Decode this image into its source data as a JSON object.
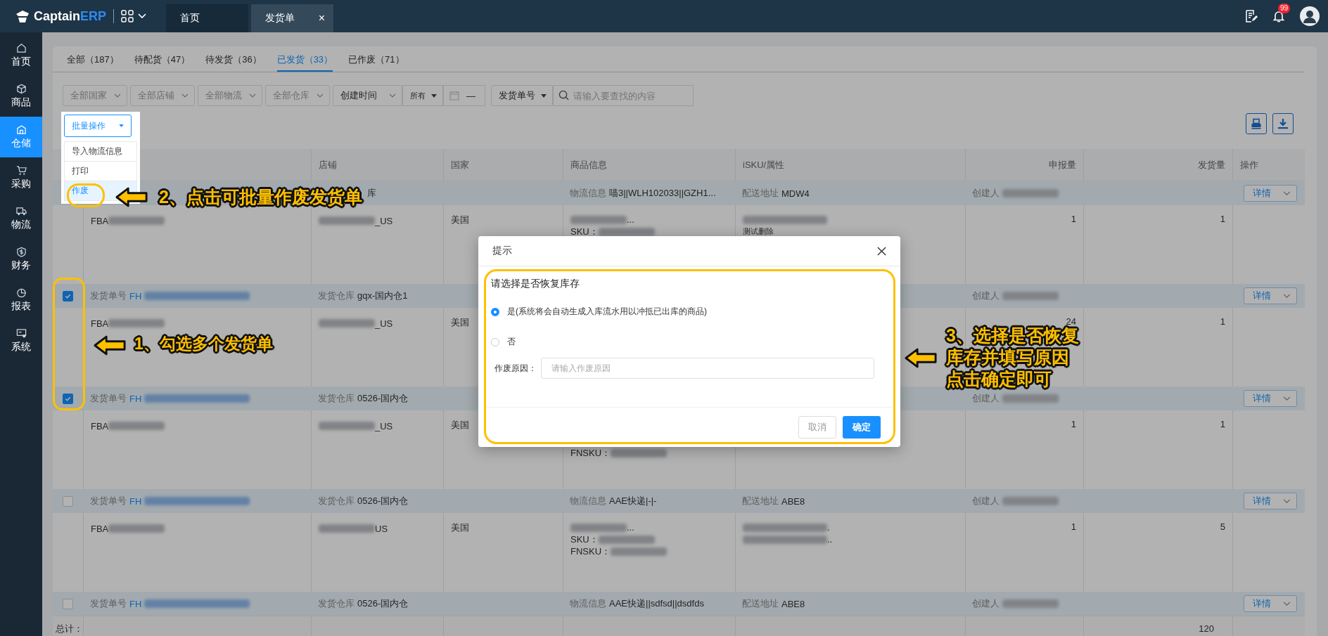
{
  "topbar": {
    "logo": {
      "part1": "Captain",
      "part2": "ERP"
    },
    "tabs": [
      {
        "label": "首页",
        "selected": false
      },
      {
        "label": "发货单",
        "selected": true,
        "close": "×"
      }
    ],
    "badge": "99"
  },
  "sidebar": [
    {
      "label": "首页",
      "selected": false
    },
    {
      "label": "商品",
      "selected": false
    },
    {
      "label": "仓储",
      "selected": true
    },
    {
      "label": "采购",
      "selected": false
    },
    {
      "label": "物流",
      "selected": false
    },
    {
      "label": "财务",
      "selected": false
    },
    {
      "label": "报表",
      "selected": false
    },
    {
      "label": "系统",
      "selected": false
    }
  ],
  "status_tabs": [
    {
      "label": "全部（187）",
      "selected": false
    },
    {
      "label": "待配货（47）",
      "selected": false
    },
    {
      "label": "待发货（36）",
      "selected": false
    },
    {
      "label": "已发货（33）",
      "selected": true
    },
    {
      "label": "已作废（71）",
      "selected": false
    }
  ],
  "filters": {
    "selects": [
      "全部国家",
      "全部店铺",
      "全部物流",
      "全部仓库"
    ],
    "time_field": "创建时间",
    "range": "所有",
    "date_dash": "—",
    "search_type": "发货单号",
    "search_placeholder": "请输入要查找的内容"
  },
  "batch": {
    "label": "批量操作",
    "menu": [
      {
        "label": "导入物流信息",
        "selected": false
      },
      {
        "label": "打印",
        "selected": false
      },
      {
        "label": "作废",
        "selected": true
      }
    ]
  },
  "table": {
    "columns": [
      "店铺",
      "国家",
      "商品信息",
      "iSKU/属性",
      "申报量",
      "发货量",
      "操作"
    ],
    "rows": [
      {
        "warehouse": {
          "value": "库"
        },
        "logistics": {
          "label": "物流信息",
          "value": "喵3||WLH102033||GZH1..."
        },
        "address": {
          "label": "配送地址",
          "value": "MDW4"
        },
        "creator": {
          "label": "创建人",
          "blur": true
        },
        "action": "详情",
        "detail": {
          "fba": [
            {
              "text": "FBA",
              "blur": true
            }
          ],
          "store": [
            {
              "blur": true,
              "tail": "_US"
            }
          ],
          "country": "美国",
          "product": [
            {
              "blur": true,
              "tail": "..."
            },
            {
              "text": "SKU：",
              "blur": true
            }
          ],
          "isku": [
            {
              "blur": true
            },
            {
              "text": "测试删除"
            }
          ],
          "declared": "1",
          "shipped": "1"
        }
      },
      {
        "checked": true,
        "order": {
          "label": "发货单号",
          "value": "FH",
          "blur": true
        },
        "warehouse": {
          "label": "发货仓库",
          "value": "gqx-国内仓1"
        },
        "creator": {
          "label": "创建人",
          "blur": true
        },
        "action": "详情",
        "detail": {
          "fba": [
            {
              "text": "FBA",
              "blur": true
            }
          ],
          "store": [
            {
              "blur": true,
              "tail": "_US"
            }
          ],
          "country": "美国",
          "declared": "24",
          "shipped": "1"
        }
      },
      {
        "checked": true,
        "order": {
          "label": "发货单号",
          "value": "FH",
          "blur": true
        },
        "warehouse": {
          "label": "发货仓库",
          "value": "0526-国内仓"
        },
        "creator": {
          "label": "创建人",
          "blur": true
        },
        "action": "详情",
        "detail": {
          "fba": [
            {
              "text": "FBA",
              "blur": true
            }
          ],
          "store": [
            {
              "blur": true,
              "tail": "_US"
            }
          ],
          "country": "美国",
          "product": [
            {
              "text": "FNSKU：",
              "blur": true
            }
          ],
          "declared": "1",
          "shipped": "1"
        }
      },
      {
        "checked": false,
        "order": {
          "label": "发货单号",
          "value": "FH",
          "blur": true
        },
        "warehouse": {
          "label": "发货仓库",
          "value": "0526-国内仓"
        },
        "logistics": {
          "label": "物流信息",
          "value": "AAE快递|-|-"
        },
        "address": {
          "label": "配送地址",
          "value": "ABE8"
        },
        "creator": {
          "label": "创建人",
          "blur": true
        },
        "action": "详情",
        "detail": {
          "fba": [
            {
              "text": "FBA",
              "blur": true
            }
          ],
          "store": [
            {
              "blur": true,
              "tail": "US"
            }
          ],
          "country": "美国",
          "product": [
            {
              "blur": true,
              "tail": "..."
            },
            {
              "text": "SKU：",
              "blur": true
            },
            {
              "text": "FNSKU：",
              "blur": true
            }
          ],
          "isku": [
            {
              "blur": true,
              "tail": "."
            },
            {
              "blur": true,
              "tail": ".."
            }
          ],
          "declared": "1",
          "shipped": "5"
        }
      },
      {
        "checked": false,
        "order": {
          "label": "发货单号",
          "value": "FH",
          "blur": true
        },
        "warehouse": {
          "label": "发货仓库",
          "value": "0526-国内仓"
        },
        "logistics": {
          "label": "物流信息",
          "value": "AAE快递||sdfsd||dsdfds"
        },
        "address": {
          "label": "配送地址",
          "value": "ABE8"
        },
        "creator": {
          "label": "创建人",
          "blur": true
        },
        "action": "详情"
      }
    ],
    "total": {
      "label": "总计：",
      "shipped": "120"
    }
  },
  "dialog": {
    "title": "提示",
    "question": "请选择是否恢复库存",
    "options": [
      {
        "label": "是(系统将会自动生成入库流水用以冲抵已出库的商品)",
        "selected": true
      },
      {
        "label": "否",
        "selected": false
      }
    ],
    "reason_label": "作废原因：",
    "reason_placeholder": "请输入作废原因",
    "cancel": "取消",
    "confirm": "确定"
  },
  "annotations": [
    {
      "lines": [
        "2、点击可批量作废发货单"
      ]
    },
    {
      "lines": [
        "1、勾选多个发货单"
      ]
    },
    {
      "lines": [
        "3、选择是否恢复",
        "库存并填写原因",
        "点击确定即可"
      ]
    }
  ]
}
